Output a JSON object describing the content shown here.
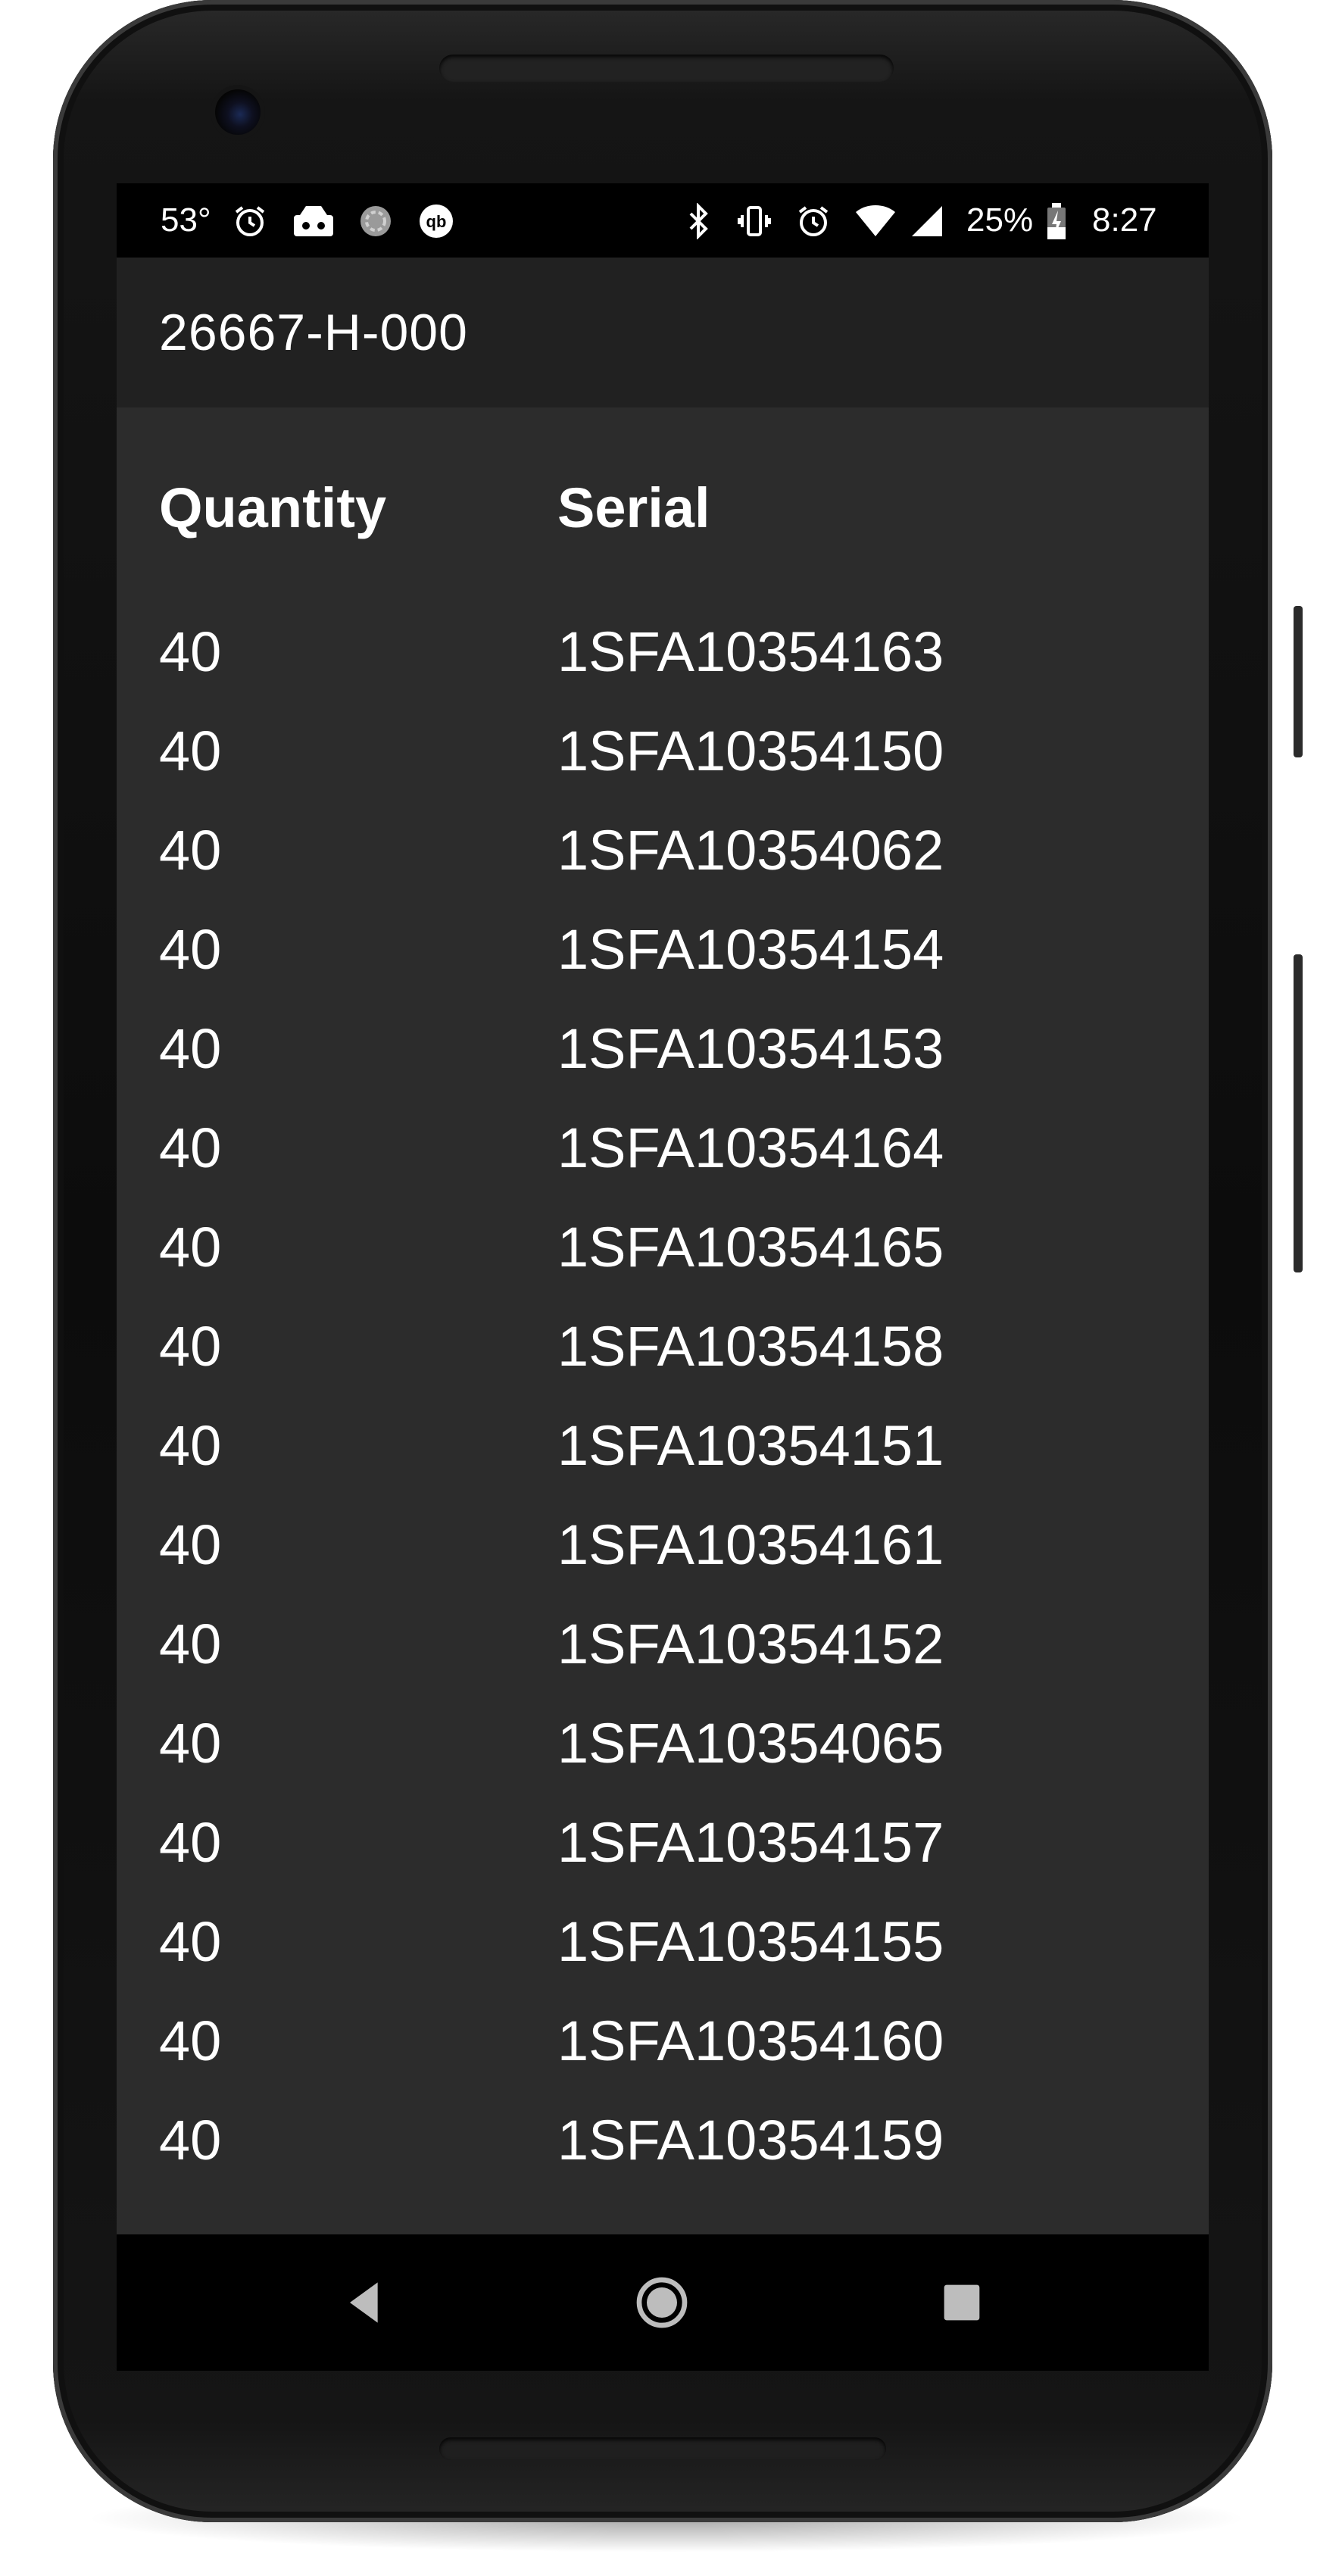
{
  "status_bar": {
    "temperature": "53°",
    "battery_percent": "25%",
    "time": "8:27",
    "left_icons": [
      "alarm-icon",
      "game-icon",
      "sync-icon",
      "quickbooks-icon"
    ],
    "right_icons": [
      "bluetooth-icon",
      "vibrate-icon",
      "alarm-icon",
      "wifi-icon",
      "signal-icon",
      "battery-charging-icon"
    ]
  },
  "app_bar": {
    "title": "26667-H-000"
  },
  "table": {
    "columns": [
      "Quantity",
      "Serial"
    ],
    "rows": [
      {
        "quantity": "40",
        "serial": "1SFA10354163"
      },
      {
        "quantity": "40",
        "serial": "1SFA10354150"
      },
      {
        "quantity": "40",
        "serial": "1SFA10354062"
      },
      {
        "quantity": "40",
        "serial": "1SFA10354154"
      },
      {
        "quantity": "40",
        "serial": "1SFA10354153"
      },
      {
        "quantity": "40",
        "serial": "1SFA10354164"
      },
      {
        "quantity": "40",
        "serial": "1SFA10354165"
      },
      {
        "quantity": "40",
        "serial": "1SFA10354158"
      },
      {
        "quantity": "40",
        "serial": "1SFA10354151"
      },
      {
        "quantity": "40",
        "serial": "1SFA10354161"
      },
      {
        "quantity": "40",
        "serial": "1SFA10354152"
      },
      {
        "quantity": "40",
        "serial": "1SFA10354065"
      },
      {
        "quantity": "40",
        "serial": "1SFA10354157"
      },
      {
        "quantity": "40",
        "serial": "1SFA10354155"
      },
      {
        "quantity": "40",
        "serial": "1SFA10354160"
      },
      {
        "quantity": "40",
        "serial": "1SFA10354159"
      }
    ]
  },
  "nav_bar": {
    "buttons": [
      "back-icon",
      "home-icon",
      "recents-icon"
    ]
  },
  "colors": {
    "screen_background": "#2c2c2c",
    "app_bar_background": "#212121",
    "text": "#ffffff",
    "system_bars": "#000000"
  }
}
